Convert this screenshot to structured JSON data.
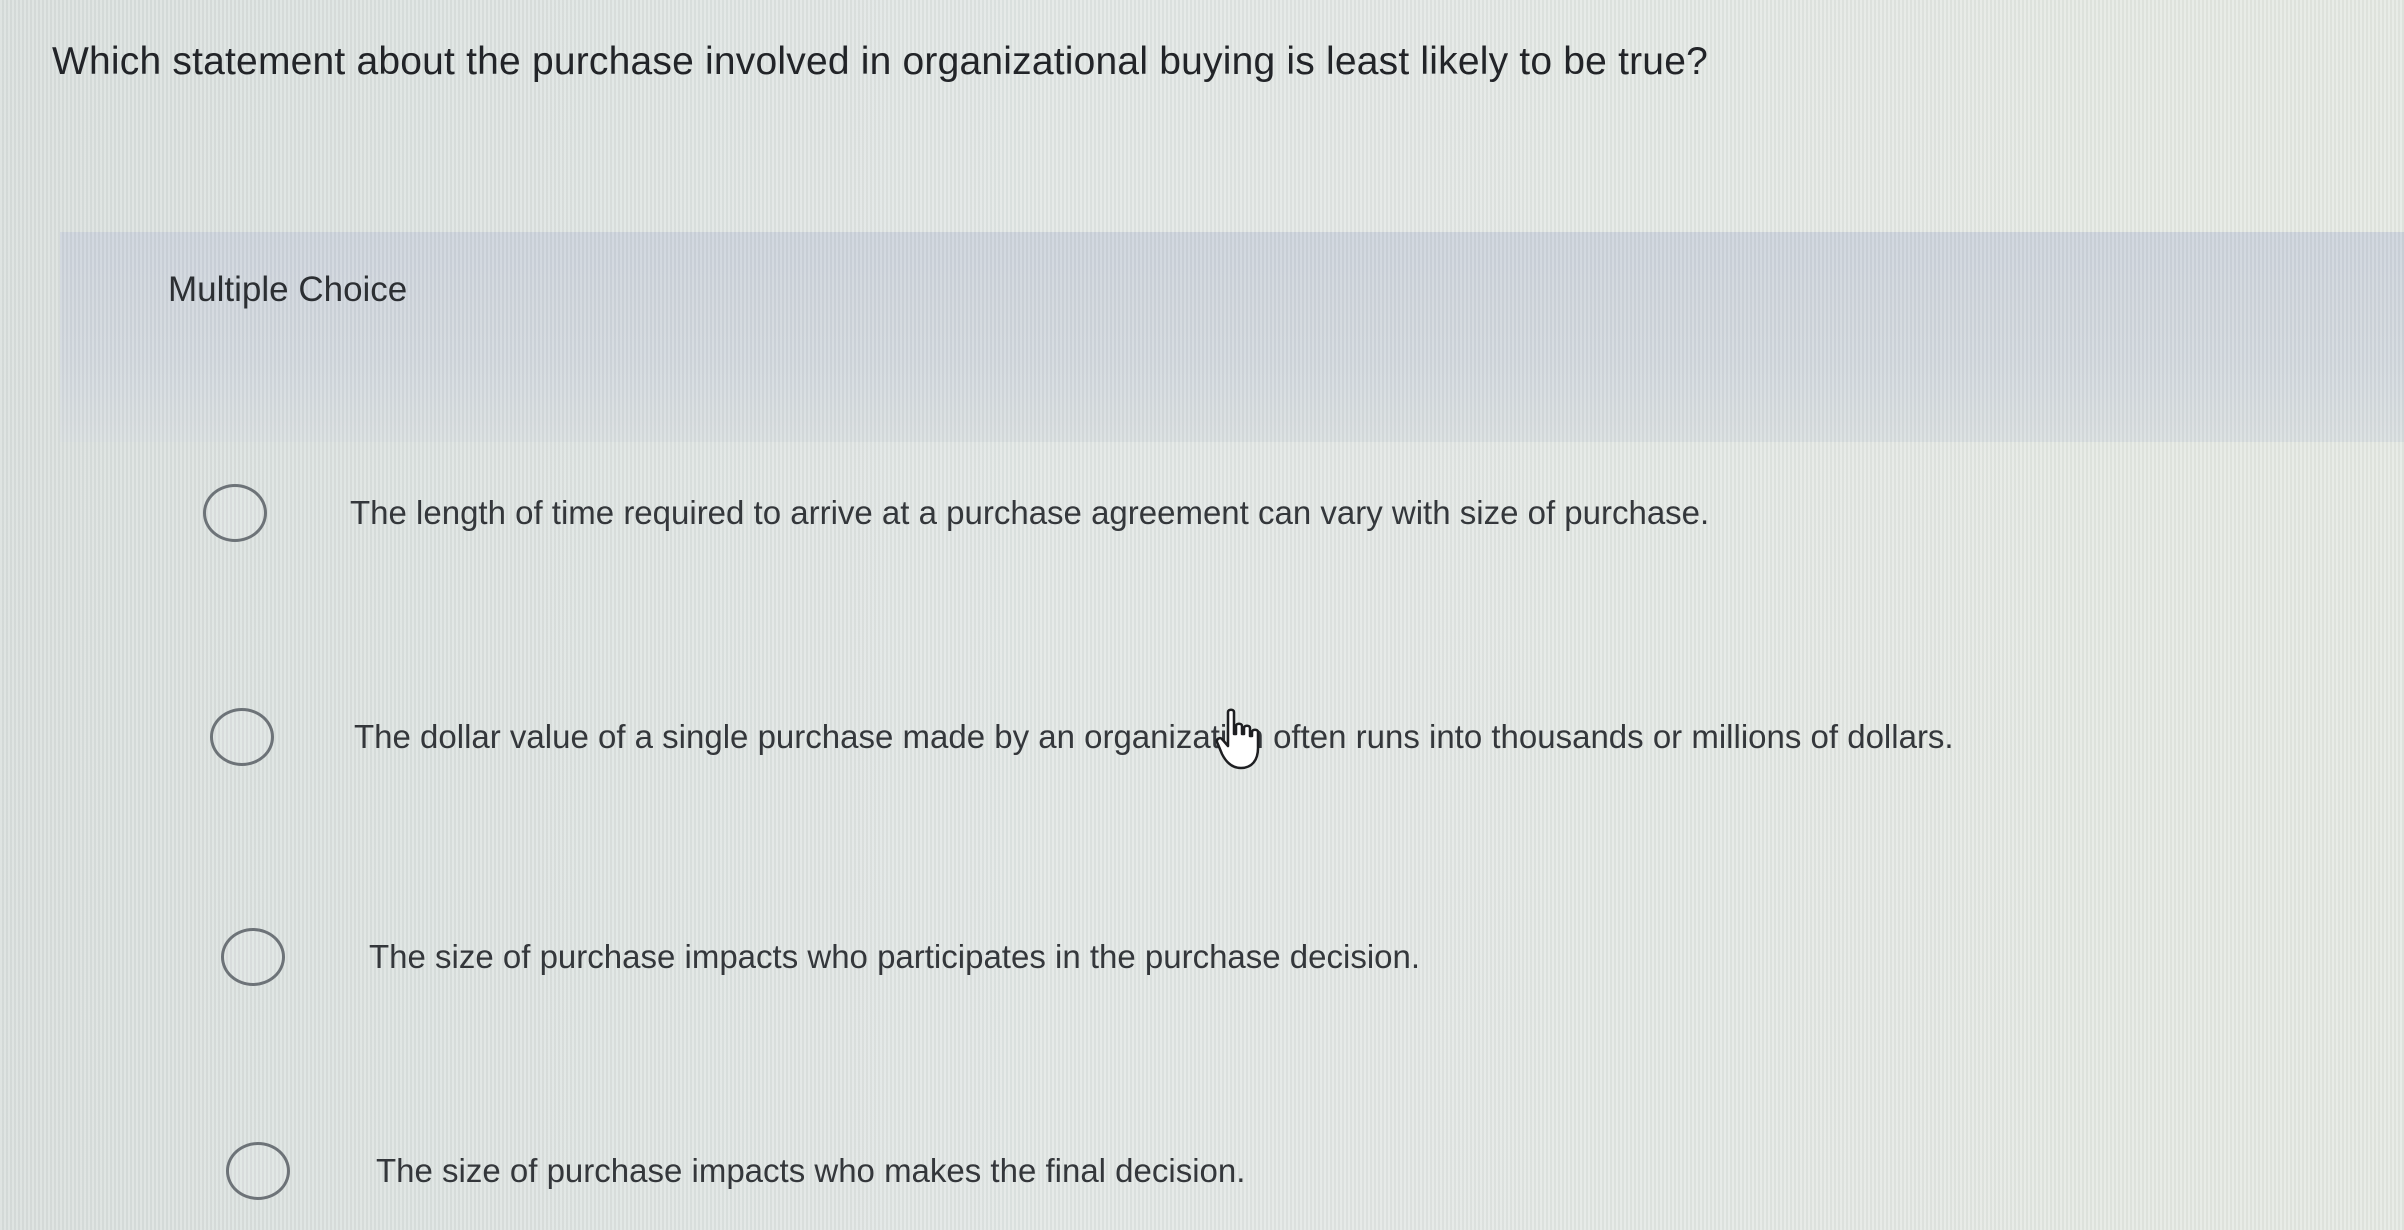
{
  "question": {
    "text": "Which statement about the purchase involved in organizational buying is least likely to be true?"
  },
  "multiple_choice": {
    "label": "Multiple Choice",
    "options": [
      {
        "label": "The length of time required to arrive at a purchase agreement can vary with size of purchase.",
        "selected": false
      },
      {
        "label": "The dollar value of a single purchase made by an organization often runs into thousands or millions of dollars.",
        "selected": false
      },
      {
        "label": "The size of purchase impacts who participates in the purchase decision.",
        "selected": false
      },
      {
        "label": "The size of purchase impacts who makes the final decision.",
        "selected": false
      }
    ]
  },
  "cursor": {
    "icon": "hand-pointer-icon"
  }
}
